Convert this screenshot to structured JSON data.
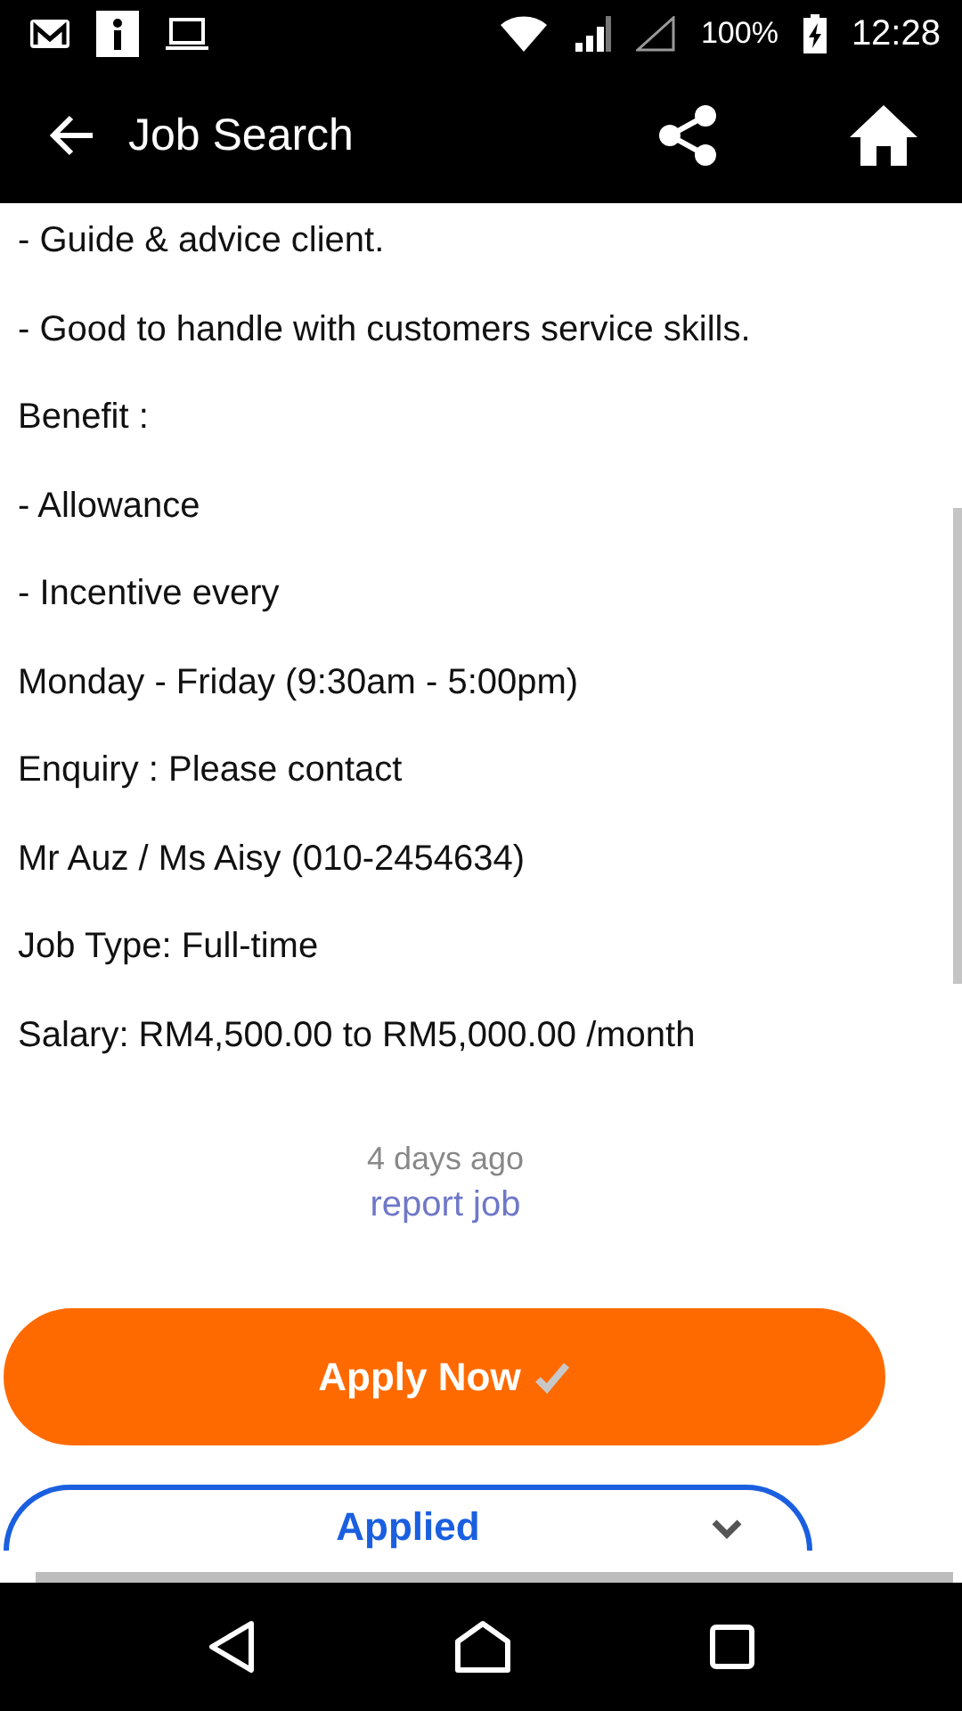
{
  "status_bar": {
    "battery": "100%",
    "time": "12:28"
  },
  "app_bar": {
    "title": "Job Search"
  },
  "description": [
    "- Guide & advice client.",
    "- Good to handle with customers service skills.",
    "Benefit :",
    "- Allowance",
    "- Incentive every",
    "Monday - Friday (9:30am - 5:00pm)",
    "Enquiry : Please contact",
    "Mr Auz / Ms Aisy (010-2454634)",
    "Job Type: Full-time",
    "Salary: RM4,500.00 to RM5,000.00 /month"
  ],
  "posted": "4 days ago",
  "report_link": "report job",
  "apply_button": {
    "label": "Apply Now"
  },
  "applied_button": {
    "label": "Applied"
  }
}
